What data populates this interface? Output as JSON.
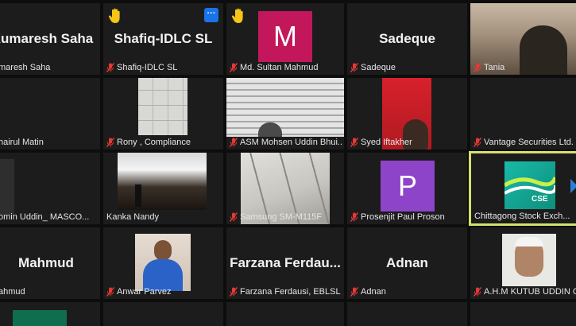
{
  "tiles": [
    {
      "big_name": "Kumaresh Saha",
      "label": "maresh Saha"
    },
    {
      "big_name": "Shafiq-IDLC SL",
      "label": "Shafiq-IDLC SL"
    },
    {
      "avatar_letter": "M",
      "label": "Md. Sultan Mahmud",
      "avatar_color": "#c2185b"
    },
    {
      "big_name": "Sadeque",
      "label": "Sadeque"
    },
    {
      "label": "Tania"
    },
    {
      "label": "hairul Matin"
    },
    {
      "label": "Rony , Compliance"
    },
    {
      "label": "ASM Mohsen Uddin Bhui..."
    },
    {
      "label": "Syed Iftakher"
    },
    {
      "label": "Vantage Securities Ltd."
    },
    {
      "label": "omin Uddin_ MASCO..."
    },
    {
      "label": "Kanka Nandy"
    },
    {
      "label": "Samsung SM-M115F"
    },
    {
      "avatar_letter": "P",
      "label": "Prosenjit Paul Proson",
      "avatar_color": "#8e44c8"
    },
    {
      "label": "Chittagong Stock Exch...",
      "logo_text": "CSE"
    },
    {
      "big_name": "Mahmud",
      "label": "ahmud"
    },
    {
      "label": "Anwar Parvez"
    },
    {
      "big_name": "Farzana  Ferdau...",
      "label": "Farzana Ferdausi, EBLSL"
    },
    {
      "big_name": "Adnan",
      "label": "Adnan"
    },
    {
      "label": "A.H.M KUTUB UDDIN Ch"
    }
  ],
  "colors": {
    "active_border": "#d4e06a",
    "muted_icon": "#e53935",
    "hand": "#f5c518"
  }
}
